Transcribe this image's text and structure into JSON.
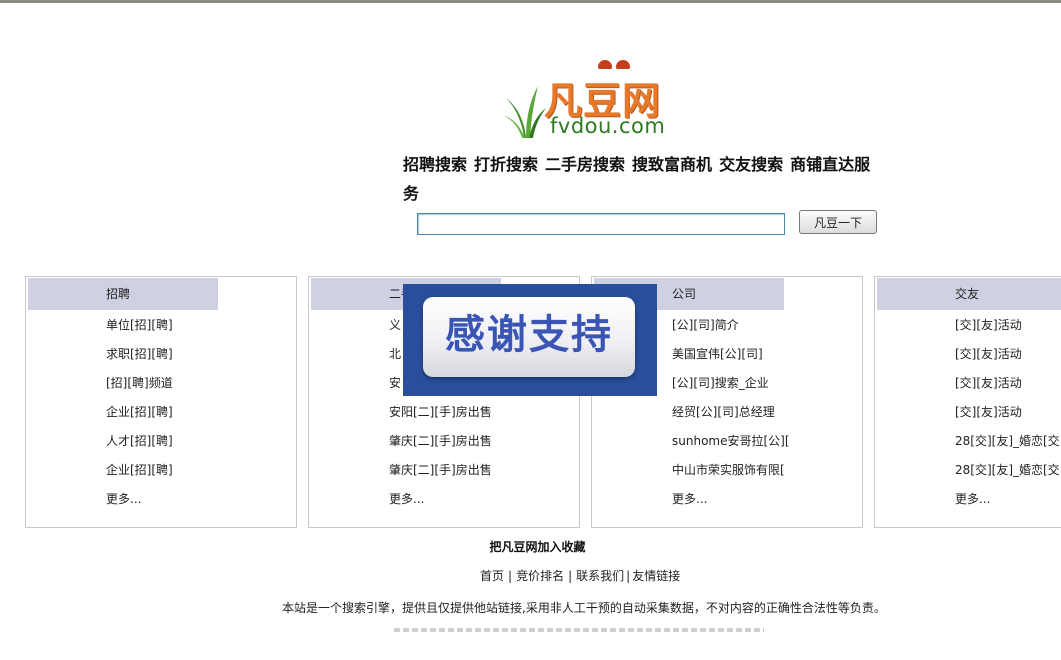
{
  "logo": {
    "cn_text": "凡豆网",
    "en_text": "fvdou.com"
  },
  "search": {
    "nav_items": [
      "招聘搜索",
      "打折搜索",
      "二手房搜索",
      "搜致富商机",
      "交友搜索",
      "商铺直达服务"
    ],
    "input_value": "",
    "button_label": "凡豆一下"
  },
  "panels": [
    {
      "title": "招聘",
      "items": [
        "单位[招][聘]",
        "求职[招][聘]",
        "[招][聘]频道",
        "企业[招][聘]",
        "人才[招][聘]",
        "企业[招][聘]",
        "更多..."
      ]
    },
    {
      "title": "二手",
      "items": [
        "义",
        "北",
        "安",
        "安阳[二][手]房出售",
        "肇庆[二][手]房出售",
        "肇庆[二][手]房出售",
        "更多..."
      ]
    },
    {
      "title": "公司",
      "items": [
        "[公][司]简介",
        "美国宣伟[公][司]",
        "[公][司]搜索_企业",
        "经贸[公][司]总经理",
        "sunhome安哥拉[公][",
        "中山市荣实服饰有限[",
        "更多..."
      ]
    },
    {
      "title": "交友",
      "items": [
        "[交][友]活动",
        "[交][友]活动",
        "[交][友]活动",
        "[交][友]活动",
        "28[交][友]_婚恋[交",
        "28[交][友]_婚恋[交",
        "更多..."
      ]
    }
  ],
  "overlay": {
    "text": "感谢支持"
  },
  "footer": {
    "favorite": "把凡豆网加入收藏",
    "links": [
      "首页",
      "竞价排名",
      "联系我们",
      "友情链接"
    ],
    "disclaimer": "本站是一个搜索引擎，提供且仅提供他站链接,采用非人工干预的自动采集数据，不对内容的正确性合法性等负责。"
  },
  "colors": {
    "panel_header": "#cfd0e2",
    "overlay_bg": "#2a4e9c",
    "overlay_text": "#3a55b4",
    "logo_orange": "#e8782a",
    "logo_green": "#2e7a1f"
  }
}
